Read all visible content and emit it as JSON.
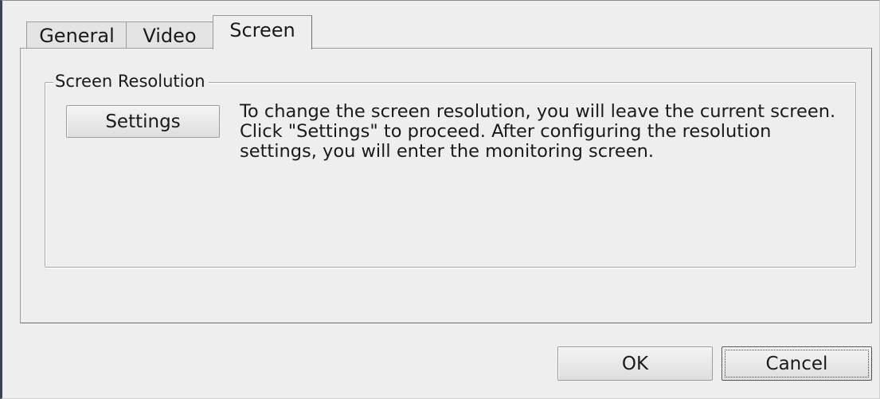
{
  "tabs": [
    {
      "label": "General",
      "selected": false
    },
    {
      "label": "Video",
      "selected": false
    },
    {
      "label": "Screen",
      "selected": true
    }
  ],
  "screen_resolution": {
    "group_title": "Screen Resolution",
    "settings_button": "Settings",
    "description": "To change the screen resolution, you will leave the current screen. Click \"Settings\" to proceed. After configuring the resolution settings, you will enter the monitoring screen."
  },
  "footer": {
    "ok_label": "OK",
    "cancel_label": "Cancel",
    "focused_button": "Cancel"
  },
  "colors": {
    "dialog_background": "#eeeeee",
    "window_edge": "#3a4452",
    "text": "#1a1a1a"
  }
}
